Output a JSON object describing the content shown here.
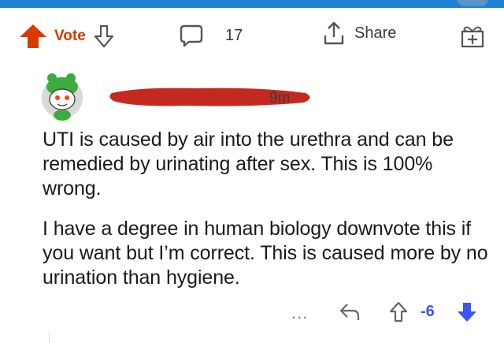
{
  "colors": {
    "upvote_orange": "#d93a00",
    "downvote_blue": "#3a56f5",
    "top_bar_blue": "#1e7fd6",
    "redaction_red": "#c4291f",
    "text_gray": "#3a3a3a"
  },
  "post_actions": {
    "vote_label": "Vote",
    "comment_count": "17",
    "share_label": "Share",
    "icons": [
      "upvote-arrow-icon",
      "downvote-arrow-icon",
      "comment-bubble-icon",
      "share-icon",
      "award-icon"
    ]
  },
  "comment": {
    "avatar_icon": "snoo-avatar-icon",
    "timestamp": "9m",
    "paragraphs": [
      "UTI is caused by air into the urethra and can be remedied by urinating after sex. This is 100% wrong.",
      "I have a degree in human biology downvote this if you want but I’m correct. This is caused more by no urination than hygiene."
    ],
    "actions": {
      "more_label": "...",
      "score": "-6",
      "icons": [
        "more-icon",
        "reply-icon",
        "upvote-icon",
        "downvote-icon"
      ]
    }
  }
}
